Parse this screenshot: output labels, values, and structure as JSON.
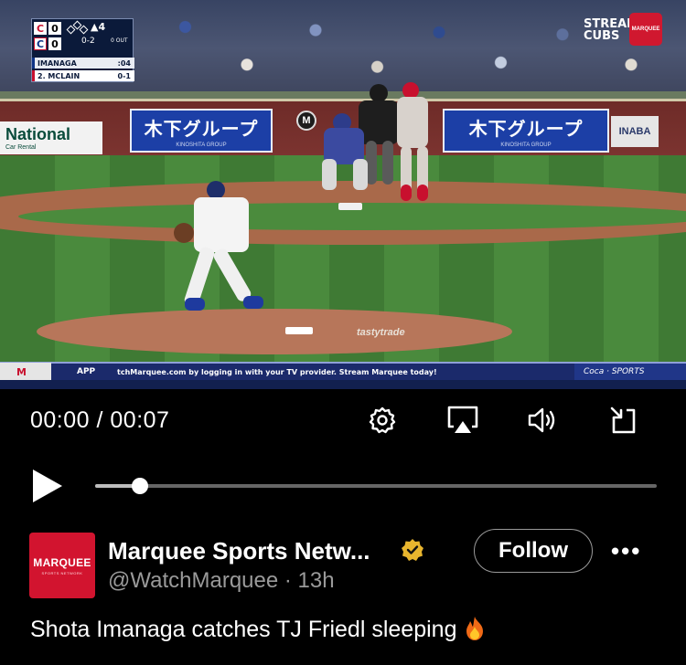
{
  "video": {
    "scorebug": {
      "away_team": "C",
      "away_score": "0",
      "home_team": "C",
      "home_score": "0",
      "inning": "▲4",
      "count": "0-2",
      "outs_label": "0 OUT",
      "pitcher": "IMANAGA",
      "pitcher_stat": ":04",
      "batter": "2. MCLAIN",
      "batter_stat": "0-1"
    },
    "stream_badge": "STREAM CUBS",
    "stream_badge_line1": "STREAM",
    "stream_badge_line2": "CUBS",
    "network_badge": "MARQUEE",
    "ads": {
      "national": "National",
      "national_sub": "Car Rental",
      "kinoshita": "木下グループ",
      "kinoshita_sub": "KINOSHITA GROUP",
      "inaba": "INABA",
      "tasty": "tastytrade"
    },
    "ticker": {
      "logo": "M",
      "app": "APP",
      "text": "tchMarquee.com by logging in with your TV provider. Stream Marquee today!",
      "brand": "Coca · SPORTS"
    }
  },
  "controls": {
    "time": "00:00 / 00:07",
    "progress": 0.08,
    "icons": [
      "settings-gear",
      "airplay",
      "volume",
      "exit-fullscreen"
    ]
  },
  "post": {
    "avatar_text": "MARQUEE",
    "avatar_sub": "SPORTS NETWORK",
    "name": "Marquee Sports Netw...",
    "handle": "@WatchMarquee · 13h",
    "follow": "Follow",
    "more": "•••",
    "caption": "Shota Imanaga catches TJ Friedl sleeping",
    "accent": "#d2142f",
    "verified_color": "#e8b52e"
  }
}
